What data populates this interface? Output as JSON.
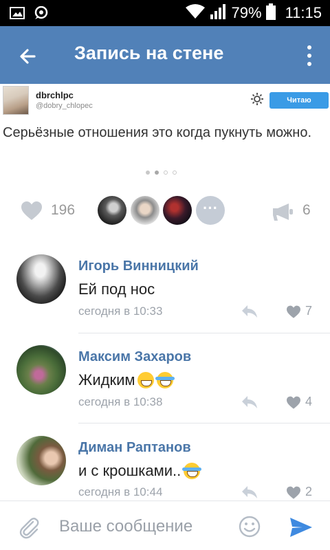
{
  "status_bar": {
    "battery": "79%",
    "time": "11:15",
    "icons": [
      "gallery-icon",
      "message-icon",
      "wifi-icon",
      "signal-icon",
      "battery-icon"
    ]
  },
  "app_bar": {
    "title": "Запись на стене",
    "back_icon": "arrow-back-icon",
    "more_icon": "more-vert-icon"
  },
  "embedded_post": {
    "name": "dbrchlpc",
    "handle": "@dobry_chlopec",
    "follow_label": "Читаю",
    "accent": "#3a9be6"
  },
  "post": {
    "text": "Серьёзные отношения это когда пукнуть можно.",
    "carousel_total": 4,
    "carousel_active": 2
  },
  "stats": {
    "likes": "196",
    "shares": "6"
  },
  "comments": [
    {
      "author": "Игорь Винницкий",
      "text": "Ей под нос",
      "emojis": [],
      "time": "сегодня в 10:33",
      "likes": "7"
    },
    {
      "author": "Максим Захаров",
      "text": "Жидким",
      "emojis": [
        "grin",
        "joy"
      ],
      "time": "сегодня в 10:38",
      "likes": "4"
    },
    {
      "author": "Диман Раптанов",
      "text": "и с крошками..",
      "emojis": [
        "joy"
      ],
      "time": "сегодня в 10:44",
      "likes": "2"
    }
  ],
  "composer": {
    "placeholder": "Ваше сообщение"
  },
  "colors": {
    "app_bar": "#5181b8",
    "link": "#4a76a8",
    "send": "#3f8ae0"
  }
}
